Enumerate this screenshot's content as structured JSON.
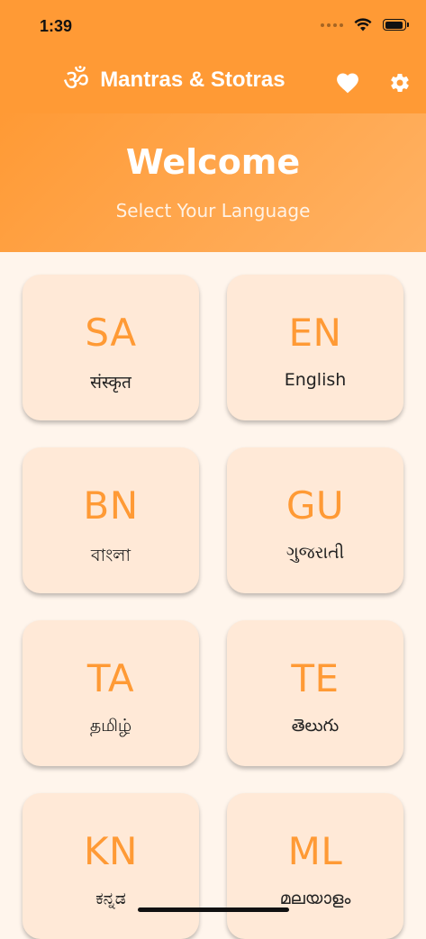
{
  "status_bar": {
    "time": "1:39"
  },
  "app_bar": {
    "logo_glyph": "ॐ",
    "title": "Mantras & Stotras",
    "favorites_icon": "heart-icon",
    "settings_icon": "gear-icon"
  },
  "hero": {
    "title": "Welcome",
    "subtitle": "Select Your Language"
  },
  "languages": [
    {
      "code": "SA",
      "name": "संस्कृत"
    },
    {
      "code": "EN",
      "name": "English"
    },
    {
      "code": "BN",
      "name": "বাংলা"
    },
    {
      "code": "GU",
      "name": "ગુજરાતી"
    },
    {
      "code": "TA",
      "name": "தமிழ்"
    },
    {
      "code": "TE",
      "name": "తెలుగు"
    },
    {
      "code": "KN",
      "name": "ಕನ್ನಡ"
    },
    {
      "code": "ML",
      "name": "മലയാളം"
    }
  ],
  "colors": {
    "primary": "#FF9A35",
    "card_background": "#FFE9D7",
    "page_background": "#FFF5EC"
  }
}
